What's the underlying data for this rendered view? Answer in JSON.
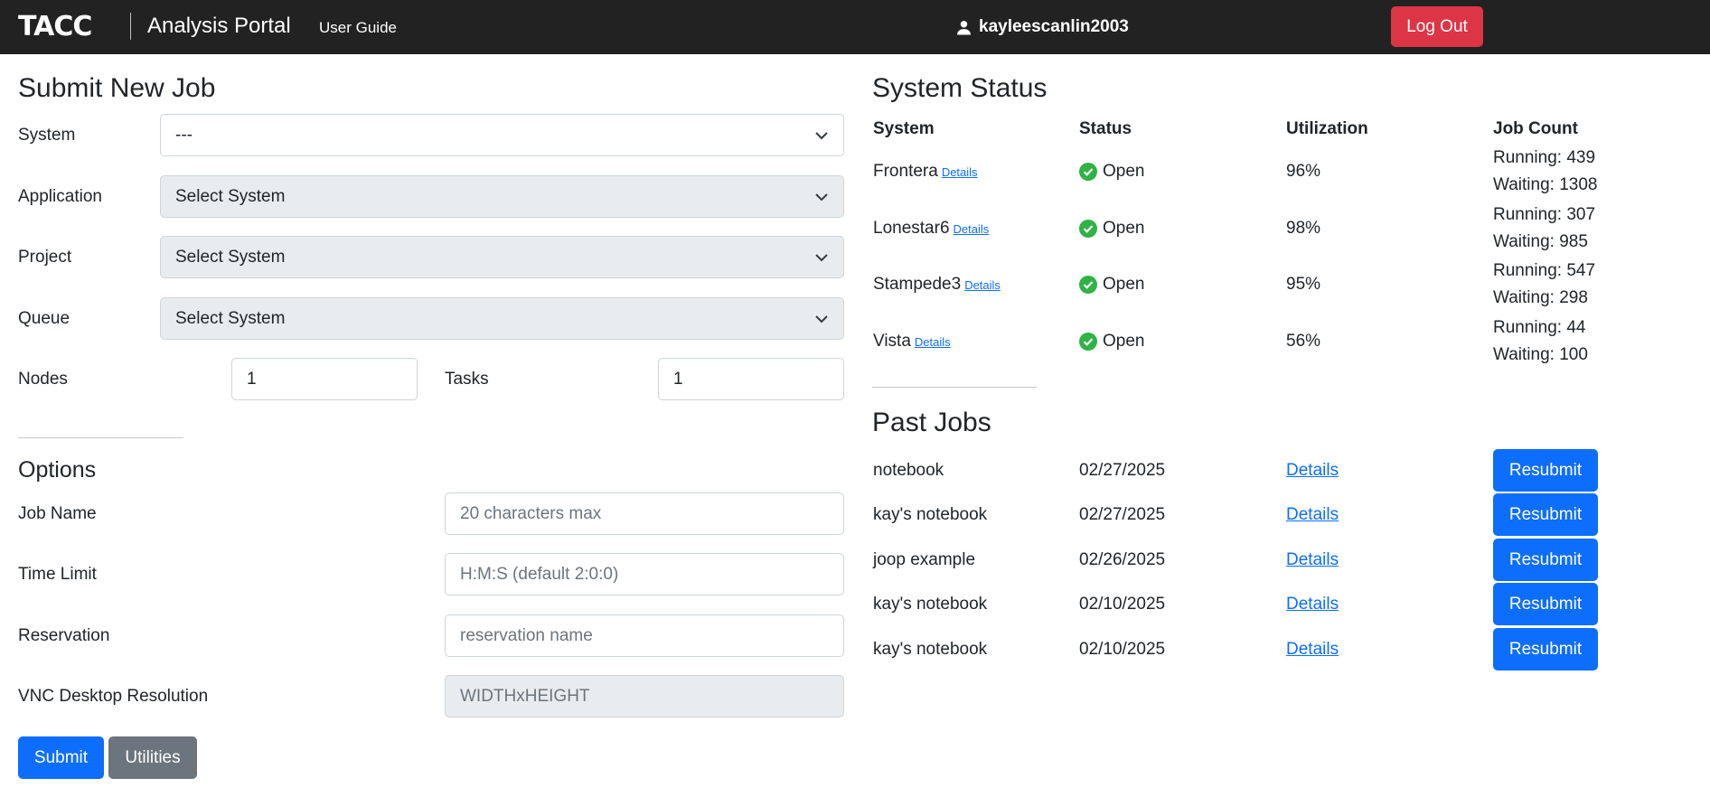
{
  "navbar": {
    "logo_text": "TACC",
    "title": "Analysis Portal",
    "user_guide": "User Guide",
    "username": "kayleescanlin2003",
    "logout": "Log Out"
  },
  "submit": {
    "heading": "Submit New Job",
    "system_label": "System",
    "system_value": "---",
    "application_label": "Application",
    "application_value": "Select System",
    "project_label": "Project",
    "project_value": "Select System",
    "queue_label": "Queue",
    "queue_value": "Select System",
    "nodes_label": "Nodes",
    "nodes_value": "1",
    "tasks_label": "Tasks",
    "tasks_value": "1"
  },
  "options": {
    "heading": "Options",
    "job_name_label": "Job Name",
    "job_name_placeholder": "20 characters max",
    "time_limit_label": "Time Limit",
    "time_limit_placeholder": "H:M:S (default 2:0:0)",
    "reservation_label": "Reservation",
    "reservation_placeholder": "reservation name",
    "vnc_label": "VNC Desktop Resolution",
    "vnc_placeholder": "WIDTHxHEIGHT",
    "submit_button": "Submit",
    "utilities_button": "Utilities"
  },
  "system_status": {
    "heading": "System Status",
    "headers": [
      "System",
      "Status",
      "Utilization",
      "Job Count"
    ],
    "details_label": "Details",
    "status_color": "#2fb344",
    "rows": [
      {
        "system": "Frontera",
        "status": "Open",
        "utilization": "96%",
        "running": "Running: 439",
        "waiting": "Waiting: 1308"
      },
      {
        "system": "Lonestar6",
        "status": "Open",
        "utilization": "98%",
        "running": "Running: 307",
        "waiting": "Waiting: 985"
      },
      {
        "system": "Stampede3",
        "status": "Open",
        "utilization": "95%",
        "running": "Running: 547",
        "waiting": "Waiting: 298"
      },
      {
        "system": "Vista",
        "status": "Open",
        "utilization": "56%",
        "running": "Running: 44",
        "waiting": "Waiting: 100"
      }
    ]
  },
  "past_jobs": {
    "heading": "Past Jobs",
    "details_label": "Details",
    "resubmit_label": "Resubmit",
    "rows": [
      {
        "name": "notebook",
        "date": "02/27/2025"
      },
      {
        "name": "kay's notebook",
        "date": "02/27/2025"
      },
      {
        "name": "joop example",
        "date": "02/26/2025"
      },
      {
        "name": "kay's notebook",
        "date": "02/10/2025"
      },
      {
        "name": "kay's notebook",
        "date": "02/10/2025"
      }
    ]
  }
}
